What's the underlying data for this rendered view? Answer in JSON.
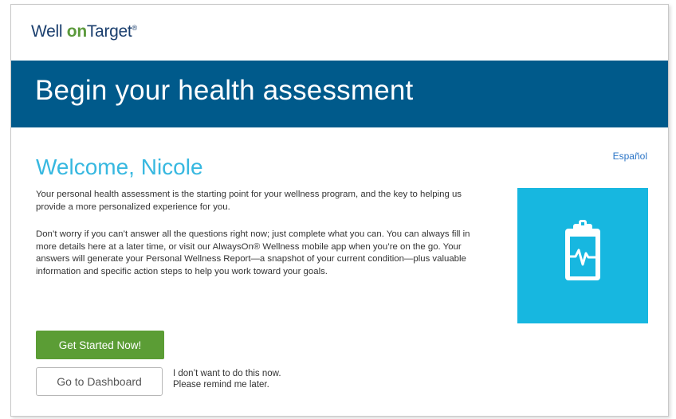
{
  "header": {
    "logo_well": "Well ",
    "logo_on": "on",
    "logo_target": "Target",
    "logo_reg": "®"
  },
  "banner": {
    "title": "Begin your health assessment"
  },
  "language_link": "Español",
  "welcome": "Welcome, Nicole",
  "intro": "Your personal health assessment is the starting point for your wellness program, and the key to helping us provide a more personalized experience for you.",
  "details": "Don’t worry if you can’t answer all the questions right now; just complete what you can. You can always fill in more details here at a later time, or visit our AlwaysOn® Wellness mobile app when you’re on the go. Your answers will generate your Personal Wellness Report—a snapshot of your current condition—plus valuable information and specific action steps to help you work toward your goals.",
  "buttons": {
    "start": "Get Started Now!",
    "dashboard": "Go to Dashboard"
  },
  "remind": {
    "line1": "I don’t want to do this now.",
    "line2": "Please remind me later."
  },
  "icons": {
    "tile": "clipboard-heartbeat-icon"
  },
  "colors": {
    "banner": "#005a8b",
    "welcome": "#37b8e0",
    "tile": "#17b7e0",
    "start_button": "#5b9d35",
    "link": "#2a74c6"
  }
}
